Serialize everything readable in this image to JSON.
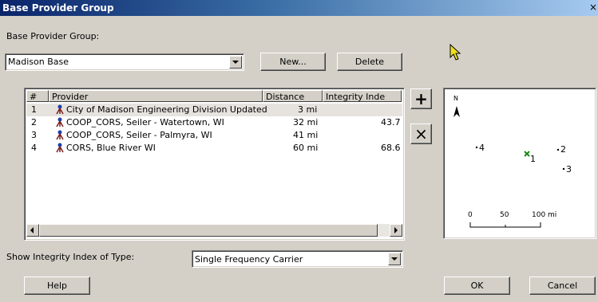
{
  "window": {
    "title": "Base Provider Group",
    "close_glyph": "×"
  },
  "group": {
    "label": "Base Provider Group:",
    "selected": "Madison Base",
    "new_label": "New...",
    "delete_label": "Delete"
  },
  "table": {
    "headers": [
      "#",
      "Provider",
      "Distance",
      "Integrity Inde"
    ],
    "rows": [
      {
        "num": "1",
        "provider": "City of Madison Engineering Division Updated",
        "distance": "3 mi",
        "integrity": ""
      },
      {
        "num": "2",
        "provider": "COOP_CORS, Seiler - Watertown, WI",
        "distance": "32 mi",
        "integrity": "43.7"
      },
      {
        "num": "3",
        "provider": "COOP_CORS, Seiler - Palmyra, WI",
        "distance": "41 mi",
        "integrity": ""
      },
      {
        "num": "4",
        "provider": "CORS, Blue River WI",
        "distance": "60 mi",
        "integrity": "68.6"
      }
    ]
  },
  "side_buttons": {
    "add_glyph": "+",
    "remove_glyph": "×"
  },
  "integrity": {
    "label": "Show Integrity Index of Type:",
    "selected": "Single Frequency Carrier"
  },
  "map": {
    "north": "N",
    "points": [
      "4",
      "1",
      "2",
      "3"
    ],
    "scale_labels": [
      "0",
      "50",
      "100 mi"
    ],
    "marker_color": "#1a8a1a"
  },
  "footer": {
    "help_label": "Help",
    "ok_label": "OK",
    "cancel_label": "Cancel"
  },
  "icons": {
    "provider_icon": "survey-antenna-icon",
    "cursor": "pointer-cursor-icon"
  }
}
